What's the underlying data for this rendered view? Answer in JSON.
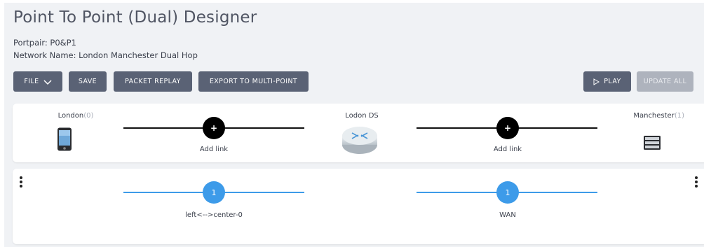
{
  "header": {
    "title": "Point To Point (Dual) Designer",
    "portpair": "Portpair: P0&P1",
    "network_name": "Network Name: London Manchester Dual Hop"
  },
  "toolbar": {
    "file_label": "FILE",
    "save_label": "SAVE",
    "packet_replay_label": "PACKET REPLAY",
    "export_label": "EXPORT TO MULTI-POINT",
    "play_label": "PLAY",
    "update_all_label": "UPDATE ALL"
  },
  "topology": {
    "left_node": {
      "name": "London",
      "count": "(0)",
      "icon": "mobile-phone-icon"
    },
    "center_node": {
      "name": "Lodon DS",
      "icon": "router-icon"
    },
    "right_node": {
      "name": "Manchester",
      "count": "(1)",
      "icon": "server-icon"
    },
    "left_link": {
      "button": "+",
      "label": "Add link"
    },
    "right_link": {
      "button": "+",
      "label": "Add link"
    }
  },
  "links": {
    "left": {
      "count": "1",
      "label": "left<-->center-0"
    },
    "right": {
      "count": "1",
      "label": "WAN"
    }
  },
  "colors": {
    "page_bg": "#f0f2f5",
    "button": "#5a6275",
    "button_disabled": "#aeb3bd",
    "link_blue": "#3d9be9",
    "link_black": "#111111"
  }
}
